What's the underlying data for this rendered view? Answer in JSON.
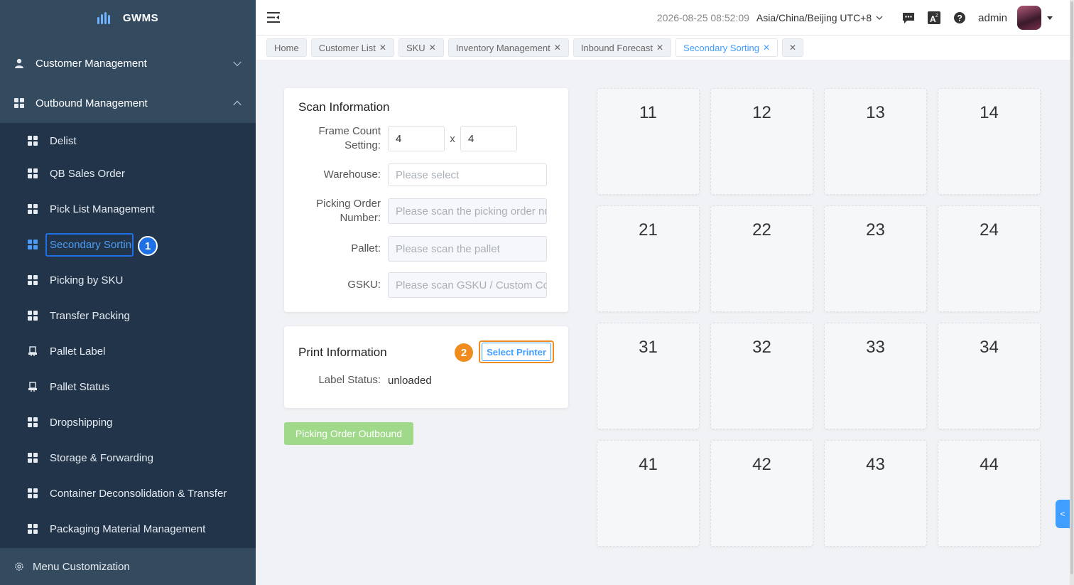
{
  "app": {
    "name": "GWMS"
  },
  "sidebar": {
    "groups": [
      {
        "label": "Customer Management",
        "expanded": false
      },
      {
        "label": "Outbound Management",
        "expanded": true
      }
    ],
    "items": [
      {
        "label": "Delist",
        "icon": "grid-icon"
      },
      {
        "label": "QB Sales Order",
        "icon": "grid-icon"
      },
      {
        "label": "Pick List Management",
        "icon": "grid-icon"
      },
      {
        "label": "Secondary Sorting",
        "icon": "grid-icon",
        "active": true
      },
      {
        "label": "Picking by SKU",
        "icon": "grid-icon"
      },
      {
        "label": "Transfer Packing",
        "icon": "grid-icon"
      },
      {
        "label": "Pallet Label",
        "icon": "printer-icon"
      },
      {
        "label": "Pallet Status",
        "icon": "printer-icon"
      },
      {
        "label": "Dropshipping",
        "icon": "grid-icon"
      },
      {
        "label": "Storage & Forwarding",
        "icon": "grid-icon"
      },
      {
        "label": "Container Deconsolidation & Transfer",
        "icon": "grid-icon"
      },
      {
        "label": "Packaging Material Management",
        "icon": "grid-icon"
      }
    ],
    "footer": "Menu Customization",
    "step_badge": "1"
  },
  "header": {
    "datetime": "2026-08-25 08:52:09",
    "timezone": "Asia/China/Beijing UTC+8",
    "user": "admin"
  },
  "tabs": [
    {
      "label": "Home",
      "closable": false
    },
    {
      "label": "Customer List",
      "closable": true
    },
    {
      "label": "SKU",
      "closable": true
    },
    {
      "label": "Inventory Management",
      "closable": true
    },
    {
      "label": "Inbound Forecast",
      "closable": true
    },
    {
      "label": "Secondary Sorting",
      "closable": true,
      "active": true
    }
  ],
  "scan": {
    "title": "Scan Information",
    "frame_label_1": "Frame Count",
    "frame_label_2": "Setting:",
    "frame_rows": "4",
    "frame_sep": "x",
    "frame_cols": "4",
    "warehouse_label": "Warehouse:",
    "warehouse_placeholder": "Please select",
    "picking_label_1": "Picking Order",
    "picking_label_2": "Number:",
    "picking_placeholder": "Please scan the picking order nu",
    "pallet_label": "Pallet:",
    "pallet_placeholder": "Please scan the pallet",
    "gsku_label": "GSKU:",
    "gsku_placeholder": "Please scan GSKU / Custom Co"
  },
  "print": {
    "title": "Print Information",
    "step_badge": "2",
    "select_printer": "Select Printer",
    "label_status_label": "Label Status:",
    "label_status_value": "unloaded"
  },
  "outbound_button": "Picking Order Outbound",
  "frames": [
    "11",
    "12",
    "13",
    "14",
    "21",
    "22",
    "23",
    "24",
    "31",
    "32",
    "33",
    "34",
    "41",
    "42",
    "43",
    "44"
  ],
  "colors": {
    "sidebar": "#344a5f",
    "submenu": "#22344a",
    "accent": "#409eff",
    "highlight": "#f08c1e",
    "success_disabled": "#a0d98a"
  }
}
